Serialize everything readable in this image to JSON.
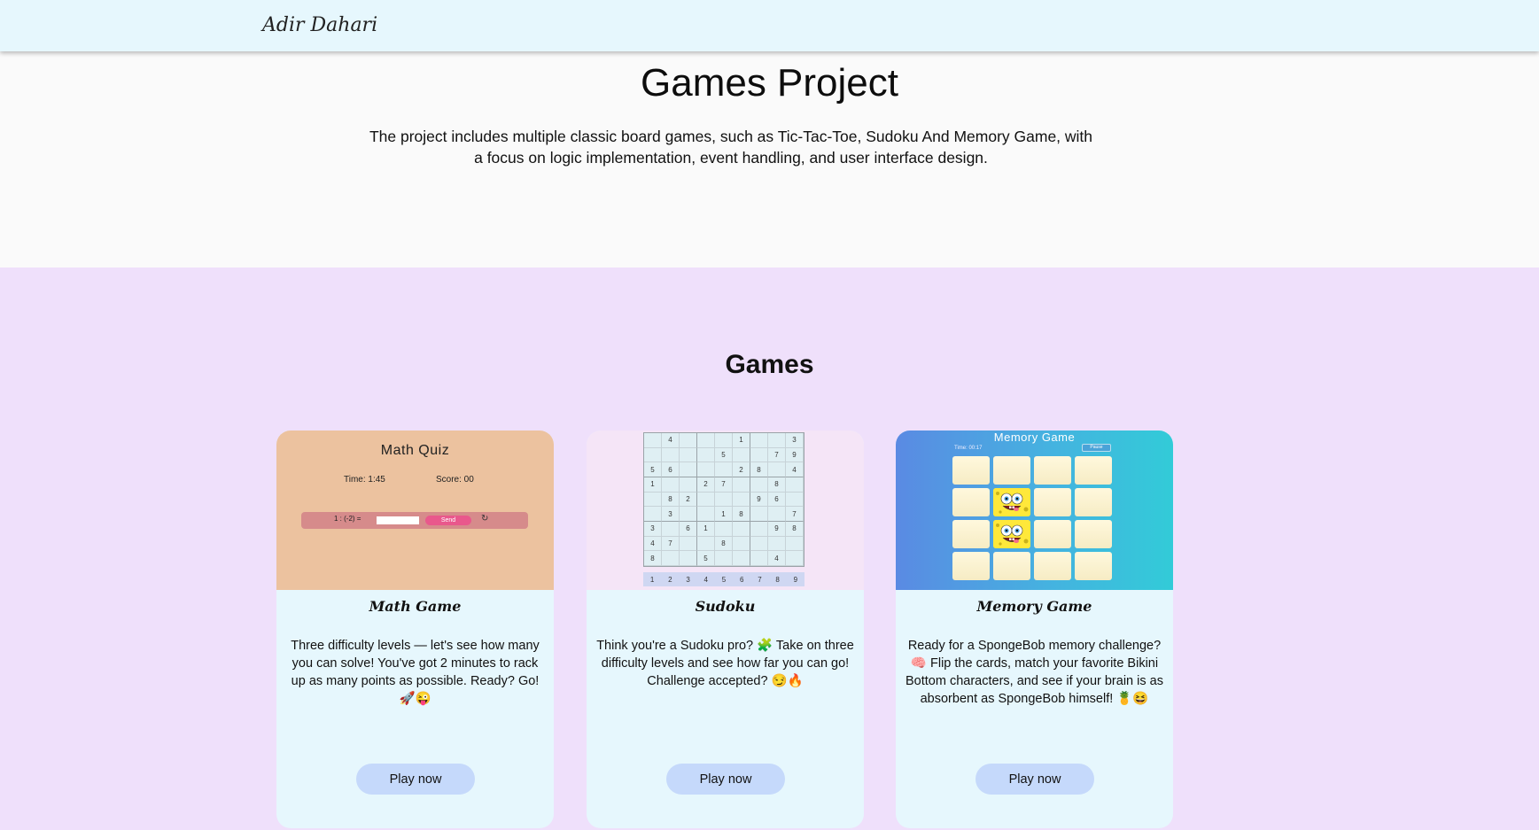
{
  "navbar": {
    "brand": "Adir Dahari"
  },
  "hero": {
    "title": "Games Project",
    "description": "The project includes multiple classic board games, such as Tic-Tac-Toe, Sudoku And Memory Game, with a focus on logic implementation, event handling, and user interface design."
  },
  "games": {
    "title": "Games",
    "cards": [
      {
        "title": "Math Game",
        "description": "Three difficulty levels — let's see how many you can solve! You've got 2 minutes to rack up as many points as possible. Ready? Go! 🚀😜",
        "button": "Play now",
        "thumbnail": {
          "title": "Math Quiz",
          "time": "Time: 1:45",
          "score": "Score: 00",
          "equation": "1 : (-2) =",
          "send": "Send",
          "refresh_icon": "↻"
        }
      },
      {
        "title": "Sudoku",
        "description": "Think you're a Sudoku pro? 🧩 Take on three difficulty levels and see how far you can go! Challenge accepted? 😏🔥",
        "button": "Play now",
        "thumbnail": {
          "grid": [
            "",
            "4",
            "",
            "",
            "",
            "1",
            "",
            "",
            "3",
            "",
            "",
            "",
            "",
            "5",
            "",
            "",
            "7",
            "9",
            "5",
            "6",
            "",
            "",
            "",
            "2",
            "8",
            "",
            "4",
            "1",
            "",
            "",
            "2",
            "7",
            "",
            "",
            "8",
            "",
            "",
            "8",
            "2",
            "",
            "",
            "",
            "9",
            "6",
            "",
            "",
            "3",
            "",
            "",
            "1",
            "8",
            "",
            "",
            "7",
            "3",
            "",
            "6",
            "1",
            "",
            "",
            "",
            "9",
            "8",
            "4",
            "7",
            "",
            "",
            "8",
            "",
            "",
            "",
            "",
            "8",
            "",
            "",
            "5",
            "",
            "",
            "",
            "4",
            ""
          ],
          "numbers": [
            "1",
            "2",
            "3",
            "4",
            "5",
            "6",
            "7",
            "8",
            "9"
          ]
        }
      },
      {
        "title": "Memory Game",
        "description": "Ready for a SpongeBob memory challenge? 🧠 Flip the cards, match your favorite Bikini Bottom characters, and see if your brain is as absorbent as SpongeBob himself! 🍍😆",
        "button": "Play now",
        "thumbnail": {
          "title": "Memory Game",
          "time": "Time: 00:17",
          "pause": "Pause",
          "revealed_cards": [
            5,
            9
          ]
        }
      }
    ]
  },
  "colors": {
    "navbar_bg": "#e6f7fd",
    "section_bg": "#efe0fb",
    "card_bg": "#e6f7fd",
    "button_bg": "#c5d9fb"
  }
}
